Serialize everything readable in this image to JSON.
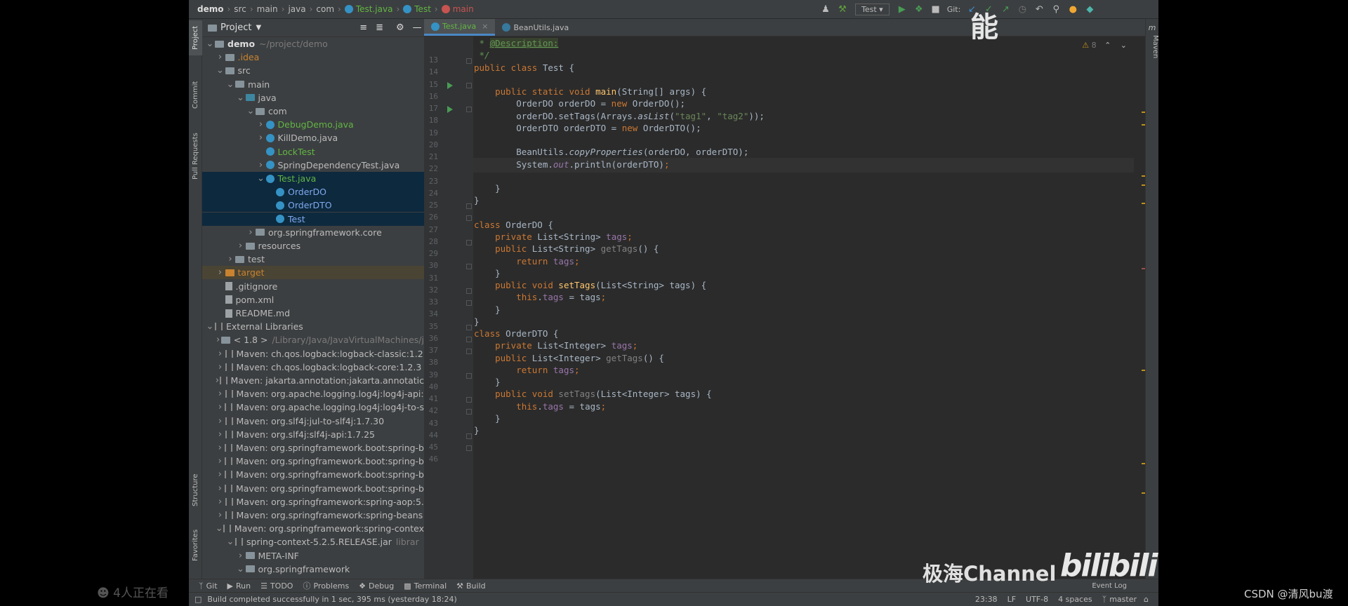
{
  "breadcrumb": [
    "demo",
    "src",
    "main",
    "java",
    "com",
    "Test.java",
    "Test",
    "main"
  ],
  "toolbar": {
    "run_config": "Test",
    "git_label": "Git:"
  },
  "left_tabs": [
    "Project",
    "Commit",
    "Pull Requests",
    "Structure",
    "Favorites"
  ],
  "project_panel": {
    "title": "Project"
  },
  "tree": [
    {
      "indent": 0,
      "arrow": "v",
      "icon": "folder",
      "label": "demo",
      "extra": "~/project/demo",
      "style": "bold"
    },
    {
      "indent": 1,
      "arrow": ">",
      "icon": "folder",
      "label": ".idea",
      "style": "orange"
    },
    {
      "indent": 1,
      "arrow": "v",
      "icon": "folder",
      "label": "src"
    },
    {
      "indent": 2,
      "arrow": "v",
      "icon": "folder",
      "label": "main"
    },
    {
      "indent": 3,
      "arrow": "v",
      "icon": "folderblue",
      "label": "java"
    },
    {
      "indent": 4,
      "arrow": "v",
      "icon": "folder",
      "label": "com"
    },
    {
      "indent": 5,
      "arrow": ">",
      "icon": "class",
      "label": "DebugDemo.java",
      "style": "green"
    },
    {
      "indent": 5,
      "arrow": ">",
      "icon": "class",
      "label": "KillDemo.java"
    },
    {
      "indent": 5,
      "arrow": "",
      "icon": "class",
      "label": "LockTest",
      "style": "green"
    },
    {
      "indent": 5,
      "arrow": ">",
      "icon": "class",
      "label": "SpringDependencyTest.java"
    },
    {
      "indent": 5,
      "arrow": "v",
      "icon": "class",
      "label": "Test.java",
      "style": "green",
      "sel": true
    },
    {
      "indent": 6,
      "arrow": "",
      "icon": "class",
      "label": "OrderDO",
      "style": "blue",
      "sel": true
    },
    {
      "indent": 6,
      "arrow": "",
      "icon": "class",
      "label": "OrderDTO",
      "style": "blue",
      "sel": true
    },
    {
      "indent": 6,
      "arrow": "",
      "icon": "class",
      "label": "Test",
      "style": "blue",
      "sel": true
    },
    {
      "indent": 4,
      "arrow": ">",
      "icon": "folder",
      "label": "org.springframework.core"
    },
    {
      "indent": 3,
      "arrow": ">",
      "icon": "folder",
      "label": "resources"
    },
    {
      "indent": 2,
      "arrow": ">",
      "icon": "folder",
      "label": "test"
    },
    {
      "indent": 1,
      "arrow": ">",
      "icon": "folderorg",
      "label": "target",
      "style": "orange",
      "tgt": true
    },
    {
      "indent": 1,
      "arrow": "",
      "icon": "file",
      "label": ".gitignore"
    },
    {
      "indent": 1,
      "arrow": "",
      "icon": "file",
      "label": "pom.xml"
    },
    {
      "indent": 1,
      "arrow": "",
      "icon": "file",
      "label": "README.md"
    },
    {
      "indent": 0,
      "arrow": "v",
      "icon": "lib",
      "label": "External Libraries"
    },
    {
      "indent": 1,
      "arrow": ">",
      "icon": "folder",
      "label": "< 1.8 >",
      "extra": "/Library/Java/JavaVirtualMachines/j"
    },
    {
      "indent": 1,
      "arrow": ">",
      "icon": "lib",
      "label": "Maven: ch.qos.logback:logback-classic:1.2"
    },
    {
      "indent": 1,
      "arrow": ">",
      "icon": "lib",
      "label": "Maven: ch.qos.logback:logback-core:1.2.3"
    },
    {
      "indent": 1,
      "arrow": ">",
      "icon": "lib",
      "label": "Maven: jakarta.annotation:jakarta.annotatic"
    },
    {
      "indent": 1,
      "arrow": ">",
      "icon": "lib",
      "label": "Maven: org.apache.logging.log4j:log4j-api:"
    },
    {
      "indent": 1,
      "arrow": ">",
      "icon": "lib",
      "label": "Maven: org.apache.logging.log4j:log4j-to-s"
    },
    {
      "indent": 1,
      "arrow": ">",
      "icon": "lib",
      "label": "Maven: org.slf4j:jul-to-slf4j:1.7.30"
    },
    {
      "indent": 1,
      "arrow": ">",
      "icon": "lib",
      "label": "Maven: org.slf4j:slf4j-api:1.7.25"
    },
    {
      "indent": 1,
      "arrow": ">",
      "icon": "lib",
      "label": "Maven: org.springframework.boot:spring-b"
    },
    {
      "indent": 1,
      "arrow": ">",
      "icon": "lib",
      "label": "Maven: org.springframework.boot:spring-b"
    },
    {
      "indent": 1,
      "arrow": ">",
      "icon": "lib",
      "label": "Maven: org.springframework.boot:spring-b"
    },
    {
      "indent": 1,
      "arrow": ">",
      "icon": "lib",
      "label": "Maven: org.springframework.boot:spring-b"
    },
    {
      "indent": 1,
      "arrow": ">",
      "icon": "lib",
      "label": "Maven: org.springframework:spring-aop:5."
    },
    {
      "indent": 1,
      "arrow": ">",
      "icon": "lib",
      "label": "Maven: org.springframework:spring-beans"
    },
    {
      "indent": 1,
      "arrow": "v",
      "icon": "lib",
      "label": "Maven: org.springframework:spring-contex"
    },
    {
      "indent": 2,
      "arrow": "v",
      "icon": "lib",
      "label": "spring-context-5.2.5.RELEASE.jar",
      "extra": "librar"
    },
    {
      "indent": 3,
      "arrow": ">",
      "icon": "folder",
      "label": "META-INF"
    },
    {
      "indent": 3,
      "arrow": "v",
      "icon": "folder",
      "label": "org.springframework"
    }
  ],
  "editor_tabs": [
    {
      "label": "Test.java",
      "active": true
    },
    {
      "label": "BeanUtils.java",
      "active": false
    }
  ],
  "line_numbers": [
    "13",
    "14",
    "15",
    "16",
    "17",
    "18",
    "19",
    "20",
    "21",
    "22",
    "23",
    "24",
    "25",
    "26",
    "27",
    "28",
    "29",
    "30",
    "31",
    "32",
    "33",
    "34",
    "35",
    "36",
    "37",
    "38",
    "39",
    "40",
    "41",
    "42",
    "43",
    "44",
    "45",
    "46"
  ],
  "code_lines": [
    [
      [
        "doc",
        " * "
      ],
      [
        "tag",
        "@Description:"
      ]
    ],
    [
      [
        "doc",
        " */"
      ]
    ],
    [
      [
        "kw",
        "public class "
      ],
      [
        "txt",
        "Test {"
      ]
    ],
    [],
    [
      [
        "txt",
        "    "
      ],
      [
        "kw",
        "public static void "
      ],
      [
        "fn",
        "main"
      ],
      [
        "txt",
        "(String[] args) {"
      ]
    ],
    [
      [
        "txt",
        "        OrderDO orderDO = "
      ],
      [
        "kw",
        "new "
      ],
      [
        "txt",
        "OrderDO();"
      ]
    ],
    [
      [
        "txt",
        "        orderDO.setTags(Arrays."
      ],
      [
        "ital",
        "asList"
      ],
      [
        "txt",
        "("
      ],
      [
        "str",
        "\"tag1\""
      ],
      [
        "txt",
        ", "
      ],
      [
        "str",
        "\"tag2\""
      ],
      [
        "txt",
        "));"
      ]
    ],
    [
      [
        "txt",
        "        OrderDTO orderDTO = "
      ],
      [
        "kw",
        "new "
      ],
      [
        "txt",
        "OrderDTO();"
      ]
    ],
    [],
    [
      [
        "txt",
        "        BeanUtils."
      ],
      [
        "ital",
        "copyProperties"
      ],
      [
        "txt",
        "(orderDO, orderDTO);"
      ]
    ],
    [
      [
        "txt",
        "        System."
      ],
      [
        "fldi",
        "out"
      ],
      [
        "txt",
        ".println(orderDTO)"
      ],
      [
        "kw",
        ";"
      ]
    ],
    [],
    [
      [
        "txt",
        "    }"
      ]
    ],
    [
      [
        "txt",
        "}"
      ]
    ],
    [],
    [
      [
        "kw",
        "class "
      ],
      [
        "txt",
        "OrderDO {"
      ]
    ],
    [
      [
        "txt",
        "    "
      ],
      [
        "kw",
        "private "
      ],
      [
        "txt",
        "List<String> "
      ],
      [
        "fld",
        "tags"
      ],
      [
        "kw",
        ";"
      ]
    ],
    [
      [
        "txt",
        "    "
      ],
      [
        "kw",
        "public "
      ],
      [
        "txt",
        "List<String> "
      ],
      [
        "grey",
        "getTags"
      ],
      [
        "txt",
        "() {"
      ]
    ],
    [
      [
        "txt",
        "        "
      ],
      [
        "kw",
        "return "
      ],
      [
        "fld",
        "tags"
      ],
      [
        "kw",
        ";"
      ]
    ],
    [
      [
        "txt",
        "    }"
      ]
    ],
    [
      [
        "txt",
        "    "
      ],
      [
        "kw",
        "public void "
      ],
      [
        "fn",
        "setTags"
      ],
      [
        "txt",
        "(List<String> tags) {"
      ]
    ],
    [
      [
        "txt",
        "        "
      ],
      [
        "kw",
        "this"
      ],
      [
        "txt",
        "."
      ],
      [
        "fld",
        "tags"
      ],
      [
        "txt",
        " = tags"
      ],
      [
        "kw",
        ";"
      ]
    ],
    [
      [
        "txt",
        "    }"
      ]
    ],
    [
      [
        "txt",
        "}"
      ]
    ],
    [
      [
        "kw",
        "class "
      ],
      [
        "txt",
        "OrderDTO {"
      ]
    ],
    [
      [
        "txt",
        "    "
      ],
      [
        "kw",
        "private "
      ],
      [
        "txt",
        "List<Integer> "
      ],
      [
        "fld",
        "tags"
      ],
      [
        "kw",
        ";"
      ]
    ],
    [
      [
        "txt",
        "    "
      ],
      [
        "kw",
        "public "
      ],
      [
        "txt",
        "List<Integer> "
      ],
      [
        "grey",
        "getTags"
      ],
      [
        "txt",
        "() {"
      ]
    ],
    [
      [
        "txt",
        "        "
      ],
      [
        "kw",
        "return "
      ],
      [
        "fld",
        "tags"
      ],
      [
        "kw",
        ";"
      ]
    ],
    [
      [
        "txt",
        "    }"
      ]
    ],
    [
      [
        "txt",
        "    "
      ],
      [
        "kw",
        "public void "
      ],
      [
        "grey",
        "setTags"
      ],
      [
        "txt",
        "(List<Integer> tags) {"
      ]
    ],
    [
      [
        "txt",
        "        "
      ],
      [
        "kw",
        "this"
      ],
      [
        "txt",
        "."
      ],
      [
        "fld",
        "tags"
      ],
      [
        "txt",
        " = tags"
      ],
      [
        "kw",
        ";"
      ]
    ],
    [
      [
        "txt",
        "    }"
      ]
    ],
    [
      [
        "txt",
        "}"
      ]
    ],
    []
  ],
  "inspection_count": "8",
  "bottom_tabs": [
    "Git",
    "Run",
    "TODO",
    "Problems",
    "Debug",
    "Terminal",
    "Build"
  ],
  "event_log": "Event Log",
  "status": {
    "message": "Build completed successfully in 1 sec, 395 ms (yesterday 18:24)",
    "position": "23:38",
    "line_sep": "LF",
    "encoding": "UTF-8",
    "indent": "4 spaces",
    "branch": "master"
  },
  "maven_label": "Maven",
  "overlay": {
    "viewers": "4人正在看",
    "channel": "极海Channel",
    "bili": "bilibili",
    "csdn": "CSDN @清风bu渡",
    "caption": "能"
  }
}
